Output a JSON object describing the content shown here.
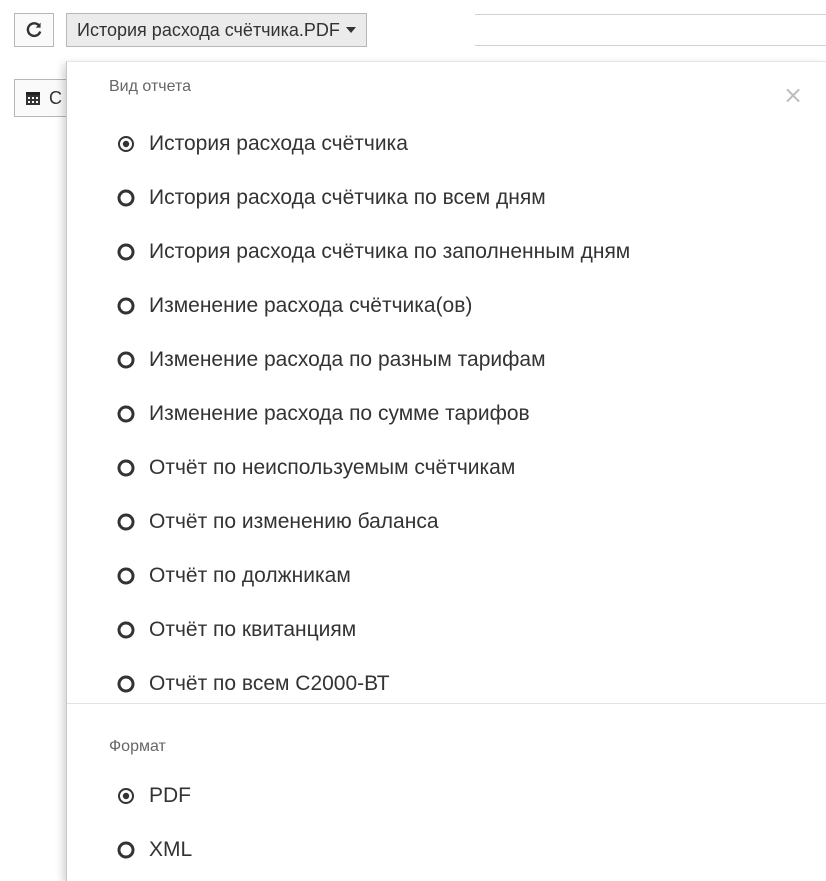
{
  "toolbar": {
    "refresh_icon": "refresh-icon",
    "report_dropdown_label": "История расхода счётчика.PDF"
  },
  "background": {
    "date_icon": "calendar-icon",
    "date_button_text": "С"
  },
  "panel": {
    "report_type_label": "Вид отчета",
    "close_label": "×",
    "report_types": [
      {
        "label": "История расхода счётчика",
        "selected": true
      },
      {
        "label": "История расхода счётчика по всем дням",
        "selected": false
      },
      {
        "label": "История расхода счётчика по заполненным дням",
        "selected": false
      },
      {
        "label": "Изменение расхода счётчика(ов)",
        "selected": false
      },
      {
        "label": "Изменение расхода по разным тарифам",
        "selected": false
      },
      {
        "label": "Изменение расхода по сумме тарифов",
        "selected": false
      },
      {
        "label": "Отчёт по неиспользуемым счётчикам",
        "selected": false
      },
      {
        "label": "Отчёт по изменению баланса",
        "selected": false
      },
      {
        "label": "Отчёт по должникам",
        "selected": false
      },
      {
        "label": "Отчёт по квитанциям",
        "selected": false
      },
      {
        "label": "Отчёт по всем С2000-ВТ",
        "selected": false
      }
    ],
    "format_label": "Формат",
    "formats": [
      {
        "label": "PDF",
        "selected": true
      },
      {
        "label": "XML",
        "selected": false
      }
    ]
  },
  "colors": {
    "text": "#333333",
    "muted": "#666666",
    "border": "#b7b7b7",
    "button_bg": "#ebebeb"
  }
}
